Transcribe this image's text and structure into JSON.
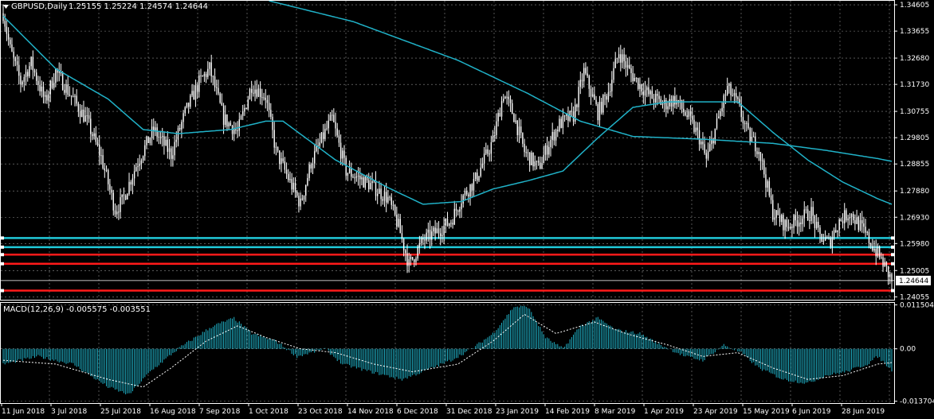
{
  "window": {
    "symbol_label": "GBPUSD,Daily",
    "ohlc": "1.25155 1.25224 1.24574 1.24644",
    "collapse_icon": "triangle-down-icon"
  },
  "indicator": {
    "label": "MACD(12,26,9) -0.005575 -0.003551"
  },
  "colors": {
    "background": "#000000",
    "candle": "#ffffff",
    "moving_average": "#20b2c8",
    "support_line_cyan": "#20c8d8",
    "resistance_line_red": "#ff1a1a",
    "grid": "#ffffff",
    "macd_hist": "#20b2c8",
    "signal": "#ffffff"
  },
  "price_axis": {
    "ticks": [
      "1.34605",
      "1.33655",
      "1.32680",
      "1.31730",
      "1.30755",
      "1.29805",
      "1.28855",
      "1.27880",
      "1.26930",
      "1.25980",
      "1.25005",
      "1.24055"
    ],
    "current_price": "1.24644"
  },
  "macd_axis": {
    "ticks": [
      "0.011504",
      "0.00",
      "-0.013704"
    ]
  },
  "time_axis": {
    "ticks": [
      "11 Jun 2018",
      "3 Jul 2018",
      "25 Jul 2018",
      "16 Aug 2018",
      "7 Sep 2018",
      "1 Oct 2018",
      "23 Oct 2018",
      "14 Nov 2018",
      "6 Dec 2018",
      "31 Dec 2018",
      "23 Jan 2019",
      "14 Feb 2019",
      "8 Mar 2019",
      "1 Apr 2019",
      "23 Apr 2019",
      "15 May 2019",
      "6 Jun 2019",
      "28 Jun 2019"
    ]
  },
  "chart_data": {
    "type": "candlestick",
    "symbol": "GBPUSD",
    "timeframe": "Daily",
    "price_range": [
      1.2395,
      1.3475
    ],
    "macd_range": [
      -0.0142,
      0.012
    ],
    "horizontal_levels": [
      {
        "price": 1.2618,
        "color": "cyan"
      },
      {
        "price": 1.2585,
        "color": "cyan"
      },
      {
        "price": 1.2558,
        "color": "red"
      },
      {
        "price": 1.2525,
        "color": "red"
      },
      {
        "price": 1.24644,
        "color": "white"
      },
      {
        "price": 1.2428,
        "color": "red"
      }
    ],
    "close_keypoints": [
      [
        0,
        1.343
      ],
      [
        4,
        1.33
      ],
      [
        10,
        1.318
      ],
      [
        16,
        1.325
      ],
      [
        24,
        1.311
      ],
      [
        30,
        1.322
      ],
      [
        40,
        1.312
      ],
      [
        48,
        1.304
      ],
      [
        56,
        1.291
      ],
      [
        64,
        1.272
      ],
      [
        68,
        1.275
      ],
      [
        76,
        1.288
      ],
      [
        86,
        1.301
      ],
      [
        96,
        1.292
      ],
      [
        104,
        1.307
      ],
      [
        112,
        1.318
      ],
      [
        118,
        1.323
      ],
      [
        126,
        1.305
      ],
      [
        134,
        1.3
      ],
      [
        142,
        1.317
      ],
      [
        150,
        1.313
      ],
      [
        156,
        1.293
      ],
      [
        164,
        1.282
      ],
      [
        170,
        1.274
      ],
      [
        176,
        1.289
      ],
      [
        184,
        1.3
      ],
      [
        188,
        1.305
      ],
      [
        196,
        1.286
      ],
      [
        202,
        1.284
      ],
      [
        210,
        1.281
      ],
      [
        220,
        1.276
      ],
      [
        226,
        1.266
      ],
      [
        232,
        1.252
      ],
      [
        240,
        1.261
      ],
      [
        250,
        1.265
      ],
      [
        256,
        1.268
      ],
      [
        262,
        1.276
      ],
      [
        270,
        1.283
      ],
      [
        280,
        1.297
      ],
      [
        286,
        1.314
      ],
      [
        292,
        1.306
      ],
      [
        298,
        1.293
      ],
      [
        306,
        1.287
      ],
      [
        312,
        1.296
      ],
      [
        318,
        1.303
      ],
      [
        326,
        1.306
      ],
      [
        332,
        1.322
      ],
      [
        340,
        1.307
      ],
      [
        346,
        1.315
      ],
      [
        352,
        1.329
      ],
      [
        358,
        1.322
      ],
      [
        364,
        1.317
      ],
      [
        370,
        1.313
      ],
      [
        378,
        1.31
      ],
      [
        384,
        1.312
      ],
      [
        392,
        1.305
      ],
      [
        398,
        1.298
      ],
      [
        402,
        1.29
      ],
      [
        408,
        1.303
      ],
      [
        414,
        1.316
      ],
      [
        420,
        1.31
      ],
      [
        426,
        1.299
      ],
      [
        432,
        1.294
      ],
      [
        440,
        1.271
      ],
      [
        448,
        1.266
      ],
      [
        456,
        1.269
      ],
      [
        462,
        1.271
      ],
      [
        466,
        1.263
      ],
      [
        472,
        1.26
      ],
      [
        478,
        1.268
      ],
      [
        484,
        1.271
      ],
      [
        490,
        1.266
      ],
      [
        496,
        1.26
      ],
      [
        502,
        1.254
      ],
      [
        508,
        1.2464
      ]
    ],
    "ema_fast_keypoints": [
      [
        0,
        1.342
      ],
      [
        30,
        1.323
      ],
      [
        60,
        1.312
      ],
      [
        80,
        1.301
      ],
      [
        100,
        1.2995
      ],
      [
        130,
        1.301
      ],
      [
        150,
        1.304
      ],
      [
        160,
        1.304
      ],
      [
        190,
        1.29
      ],
      [
        220,
        1.28
      ],
      [
        240,
        1.274
      ],
      [
        262,
        1.275
      ],
      [
        280,
        1.2795
      ],
      [
        300,
        1.2825
      ],
      [
        320,
        1.286
      ],
      [
        340,
        1.298
      ],
      [
        360,
        1.309
      ],
      [
        380,
        1.311
      ],
      [
        400,
        1.311
      ],
      [
        420,
        1.311
      ],
      [
        440,
        1.3
      ],
      [
        460,
        1.29
      ],
      [
        480,
        1.282
      ],
      [
        500,
        1.276
      ],
      [
        508,
        1.274
      ]
    ],
    "ema_slow_keypoints": [
      [
        152,
        1.3475
      ],
      [
        200,
        1.34
      ],
      [
        260,
        1.326
      ],
      [
        300,
        1.314
      ],
      [
        330,
        1.304
      ],
      [
        360,
        1.2985
      ],
      [
        400,
        1.2975
      ],
      [
        440,
        1.296
      ],
      [
        470,
        1.2935
      ],
      [
        500,
        1.2905
      ],
      [
        508,
        1.2895
      ]
    ],
    "macd_hist_keypoints": [
      [
        0,
        -0.004
      ],
      [
        20,
        -0.002
      ],
      [
        40,
        -0.004
      ],
      [
        60,
        -0.01
      ],
      [
        72,
        -0.012
      ],
      [
        84,
        -0.006
      ],
      [
        100,
        0.0
      ],
      [
        120,
        0.006
      ],
      [
        132,
        0.008
      ],
      [
        142,
        0.004
      ],
      [
        156,
        0.002
      ],
      [
        168,
        -0.002
      ],
      [
        184,
        0.0
      ],
      [
        194,
        -0.004
      ],
      [
        210,
        -0.006
      ],
      [
        228,
        -0.008
      ],
      [
        240,
        -0.006
      ],
      [
        256,
        -0.003
      ],
      [
        268,
        0.0
      ],
      [
        280,
        0.004
      ],
      [
        292,
        0.011
      ],
      [
        300,
        0.011
      ],
      [
        310,
        0.003
      ],
      [
        320,
        0.0
      ],
      [
        330,
        0.006
      ],
      [
        340,
        0.008
      ],
      [
        350,
        0.005
      ],
      [
        364,
        0.004
      ],
      [
        376,
        0.001
      ],
      [
        390,
        -0.002
      ],
      [
        400,
        -0.003
      ],
      [
        412,
        0.001
      ],
      [
        422,
        -0.001
      ],
      [
        432,
        -0.005
      ],
      [
        446,
        -0.008
      ],
      [
        460,
        -0.009
      ],
      [
        470,
        -0.007
      ],
      [
        482,
        -0.006
      ],
      [
        494,
        -0.004
      ],
      [
        500,
        -0.002
      ],
      [
        508,
        -0.0056
      ]
    ],
    "macd_signal_keypoints": [
      [
        0,
        -0.003
      ],
      [
        30,
        -0.004
      ],
      [
        60,
        -0.008
      ],
      [
        80,
        -0.01
      ],
      [
        96,
        -0.005
      ],
      [
        116,
        0.002
      ],
      [
        134,
        0.006
      ],
      [
        150,
        0.003
      ],
      [
        170,
        0.0
      ],
      [
        190,
        -0.001
      ],
      [
        212,
        -0.004
      ],
      [
        234,
        -0.006
      ],
      [
        260,
        -0.004
      ],
      [
        280,
        0.002
      ],
      [
        298,
        0.009
      ],
      [
        316,
        0.004
      ],
      [
        338,
        0.007
      ],
      [
        356,
        0.004
      ],
      [
        380,
        0.001
      ],
      [
        400,
        -0.002
      ],
      [
        420,
        -0.001
      ],
      [
        440,
        -0.005
      ],
      [
        460,
        -0.008
      ],
      [
        480,
        -0.007
      ],
      [
        500,
        -0.004
      ],
      [
        508,
        -0.0036
      ]
    ]
  }
}
